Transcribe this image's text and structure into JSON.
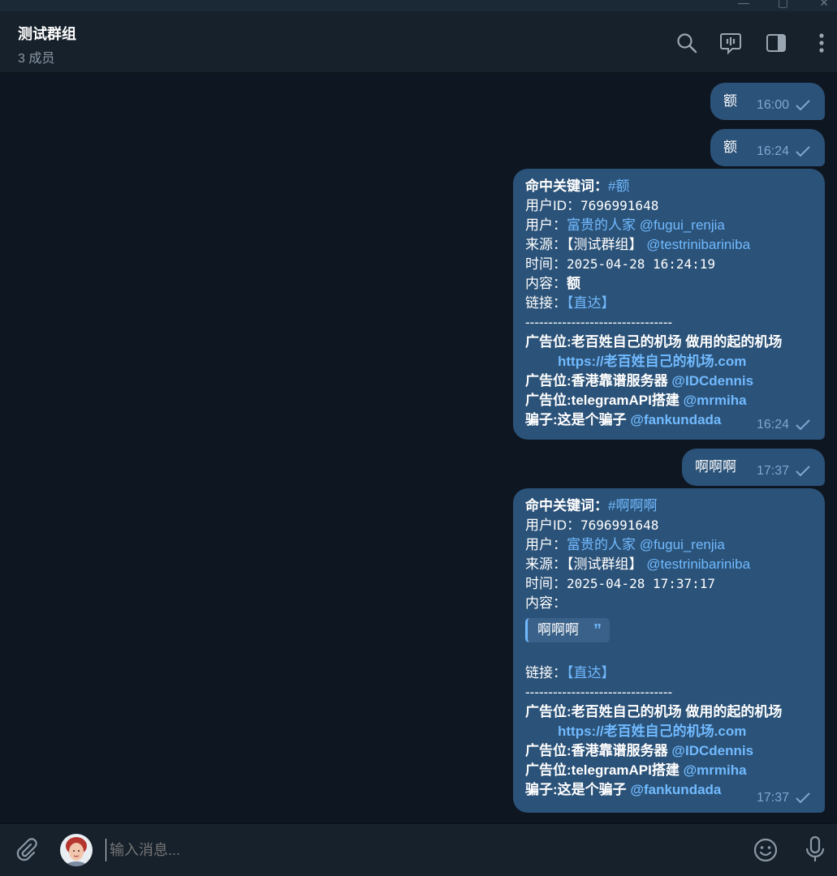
{
  "window": {
    "min": "—",
    "max": "▢",
    "close": "✕"
  },
  "header": {
    "title": "测试群组",
    "subtitle": "3 成员"
  },
  "messages": [
    {
      "text": "额",
      "time": "16:00"
    },
    {
      "text": "额",
      "time": "16:24"
    },
    {
      "time": "16:24",
      "keyword_label": "命中关键词：",
      "keyword": "#额",
      "uid_label": "用户ID：",
      "uid": "7696991648",
      "user_label": "用户：",
      "user_name": "富贵的人家",
      "user_handle": "@fugui_renjia",
      "source_label": "来源：",
      "source_group": "【测试群组】",
      "source_handle": "@testrinibariniba",
      "time_label": "时间：",
      "timestamp": "2025-04-28 16:24:19",
      "content_label": "内容：",
      "content": "额",
      "link_label": "链接：",
      "link": "【直达】",
      "divider": "--------------------------------",
      "ad1": "广告位:老百姓自己的机场 做用的起的机场",
      "ad1_url": "https://老百姓自己的机场.com",
      "ad2": "广告位:香港靠谱服务器 ",
      "ad2_handle": "@IDCdennis",
      "ad3": "广告位:telegramAPI搭建 ",
      "ad3_handle": "@mrmiha",
      "ad4": "骗子:这是个骗子 ",
      "ad4_handle": "@fankundada"
    },
    {
      "text": "啊啊啊",
      "time": "17:37"
    },
    {
      "time": "17:37",
      "keyword_label": "命中关键词：",
      "keyword": "#啊啊啊",
      "uid_label": "用户ID：",
      "uid": "7696991648",
      "user_label": "用户：",
      "user_name": "富贵的人家",
      "user_handle": "@fugui_renjia",
      "source_label": "来源：",
      "source_group": "【测试群组】",
      "source_handle": "@testrinibariniba",
      "time_label": "时间：",
      "timestamp": "2025-04-28 17:37:17",
      "content_label": "内容：",
      "content_quote": "啊啊啊",
      "link_label": "链接：",
      "link": "【直达】",
      "divider": "--------------------------------",
      "ad1": "广告位:老百姓自己的机场 做用的起的机场",
      "ad1_url": "https://老百姓自己的机场.com",
      "ad2": "广告位:香港靠谱服务器 ",
      "ad2_handle": "@IDCdennis",
      "ad3": "广告位:telegramAPI搭建 ",
      "ad3_handle": "@mrmiha",
      "ad4": "骗子:这是个骗子 ",
      "ad4_handle": "@fankundada"
    }
  ],
  "composer": {
    "placeholder": "输入消息..."
  },
  "icons": {
    "header": [
      "search-icon",
      "topics-icon",
      "side-panel-icon",
      "more-menu-icon"
    ],
    "composer": [
      "attach-icon",
      "avatar",
      "emoji-icon",
      "mic-icon"
    ],
    "status": "check-icon"
  },
  "colors": {
    "background": "#0e1621",
    "header": "#17212b",
    "bubble": "#2b5278",
    "link": "#71baff",
    "meta": "#7da8d3"
  }
}
